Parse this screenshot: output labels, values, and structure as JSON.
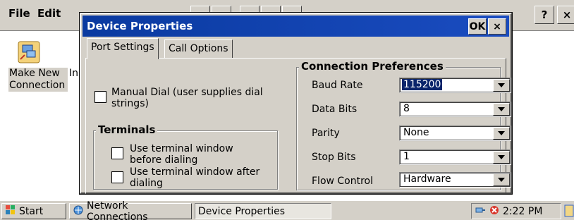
{
  "background_app": {
    "menu": [
      "File",
      "Edit"
    ],
    "help_button": "?",
    "close_button": "×",
    "desktop_item_label": "Make New Connection",
    "desktop_item2_label": "In"
  },
  "dialog": {
    "title": "Device Properties",
    "ok_label": "OK",
    "close_label": "×",
    "tabs": [
      "Port Settings",
      "Call Options"
    ],
    "manual_dial_label": "Manual Dial (user supplies dial strings)",
    "terminals_title": "Terminals",
    "terminal_before_label": "Use terminal window before dialing",
    "terminal_after_label": "Use terminal window after dialing",
    "connection_title": "Connection Preferences",
    "fields": [
      {
        "label": "Baud Rate",
        "value": "115200"
      },
      {
        "label": "Data Bits",
        "value": "8"
      },
      {
        "label": "Parity",
        "value": "None"
      },
      {
        "label": "Stop Bits",
        "value": "1"
      },
      {
        "label": "Flow Control",
        "value": "Hardware"
      }
    ]
  },
  "taskbar": {
    "start_label": "Start",
    "buttons": [
      "Network Connections",
      "Device Properties"
    ],
    "clock": "2:22 PM"
  },
  "colors": {
    "titlebar": "#0a246a",
    "face": "#d4d0c8",
    "selection": "#0a246a"
  }
}
